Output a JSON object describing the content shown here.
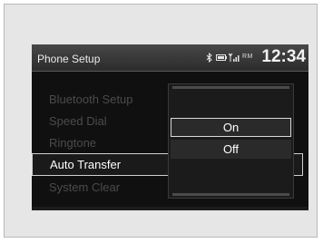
{
  "header": {
    "title": "Phone Setup",
    "roaming": "RM",
    "clock": "12:34"
  },
  "menu": {
    "items": [
      {
        "label": "Bluetooth Setup"
      },
      {
        "label": "Speed Dial"
      },
      {
        "label": "Ringtone"
      },
      {
        "label": "Auto Transfer"
      },
      {
        "label": "System Clear"
      }
    ],
    "selected": "Auto Transfer"
  },
  "popup": {
    "options": [
      {
        "label": "On"
      },
      {
        "label": "Off"
      }
    ],
    "highlighted": "On"
  },
  "icons": {
    "status": [
      "bluetooth-icon",
      "battery-icon",
      "signal-icon"
    ]
  },
  "colors": {
    "background": "#101010",
    "header": "#3a3a3a",
    "text_active": "#ffffff",
    "text_dimmed": "#4b4b4b",
    "highlight_border": "#d8d8d8"
  }
}
